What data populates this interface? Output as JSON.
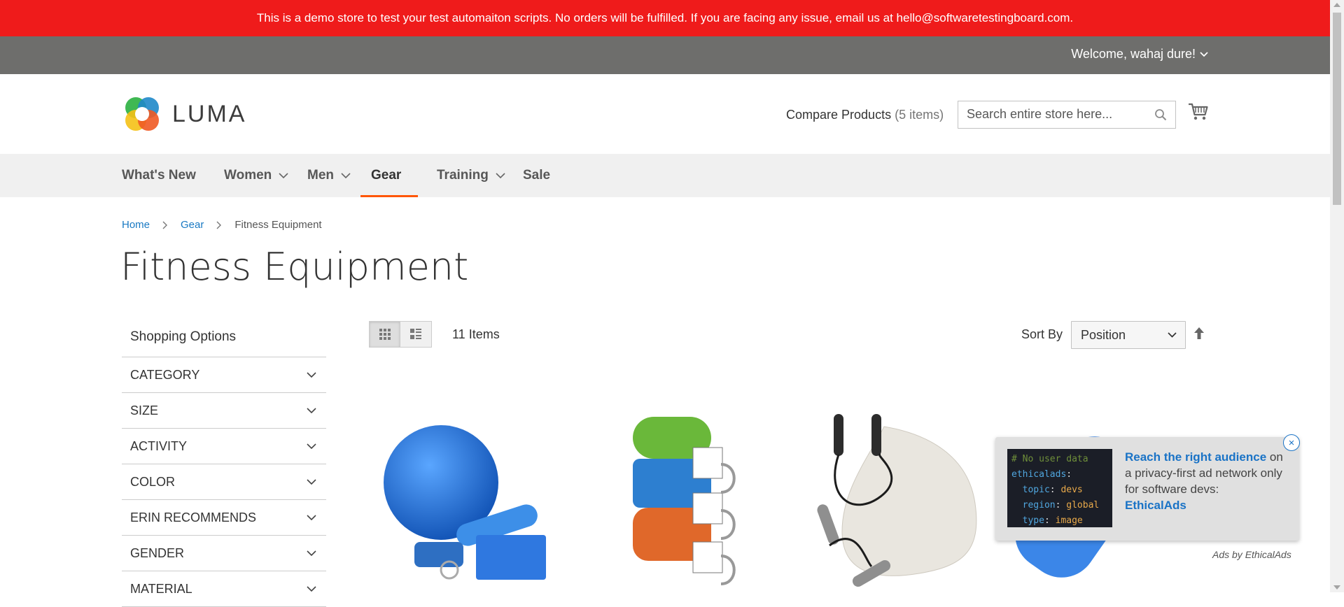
{
  "demo_notice": "This is a demo store to test your test automaiton scripts. No orders will be fulfilled. If you are facing any issue, email us at hello@softwaretestingboard.com.",
  "header": {
    "welcome": "Welcome, wahaj dure!",
    "logo_text": "LUMA",
    "compare_label": "Compare Products",
    "compare_count": "(5 items)",
    "search_placeholder": "Search entire store here...",
    "icons": {
      "search": "search-icon",
      "cart": "cart-icon"
    }
  },
  "nav": {
    "items": [
      {
        "label": "What's New",
        "has_dropdown": false,
        "active": false
      },
      {
        "label": "Women",
        "has_dropdown": true,
        "active": false
      },
      {
        "label": "Men",
        "has_dropdown": true,
        "active": false
      },
      {
        "label": "Gear",
        "has_dropdown": true,
        "active": true
      },
      {
        "label": "Training",
        "has_dropdown": true,
        "active": false
      },
      {
        "label": "Sale",
        "has_dropdown": false,
        "active": false
      }
    ],
    "active_color": "#ff5501"
  },
  "breadcrumb": {
    "items": [
      "Home",
      "Gear"
    ],
    "current": "Fitness Equipment"
  },
  "page_title": "Fitness Equipment",
  "sidebar": {
    "title": "Shopping Options",
    "filters": [
      "CATEGORY",
      "SIZE",
      "ACTIVITY",
      "COLOR",
      "ERIN RECOMMENDS",
      "GENDER",
      "MATERIAL"
    ]
  },
  "toolbar": {
    "items_count": "11",
    "items_label": "Items",
    "sort_label": "Sort By",
    "sort_value": "Position",
    "view_modes": [
      "grid",
      "list"
    ]
  },
  "ad": {
    "code_lines": [
      {
        "key": "# No user data",
        "value": ""
      },
      {
        "key": "ethicalads",
        "value": ":"
      },
      {
        "key": "  topic",
        "value": "devs"
      },
      {
        "key": "  region",
        "value": "global"
      },
      {
        "key": "  type",
        "value": "image"
      }
    ],
    "headline": "Reach the right audience",
    "text_suffix": " on a privacy-first ad network only for software devs:",
    "brand": "EthicalAds",
    "footer": "Ads by EthicalAds",
    "close": "×"
  },
  "colors": {
    "demo_bar": "#ef1b1b",
    "top_bar": "#6e6e6c",
    "link": "#1979c3"
  }
}
